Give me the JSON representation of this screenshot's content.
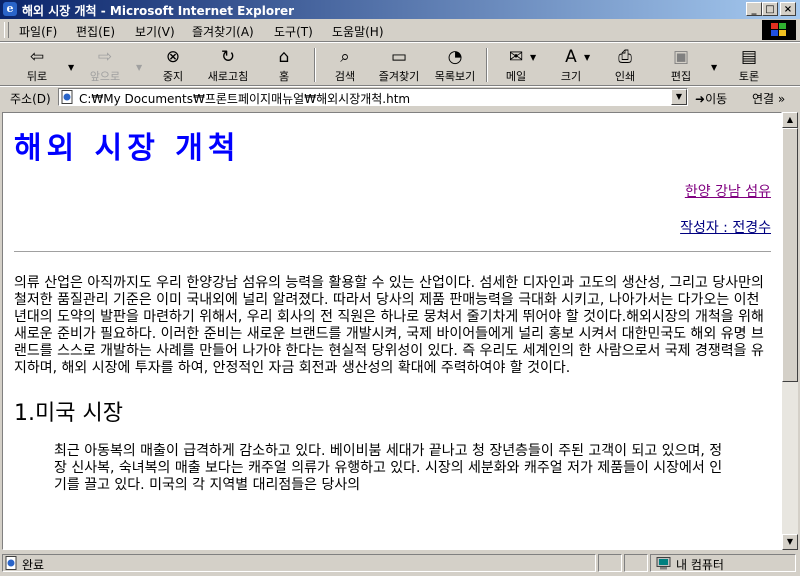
{
  "window": {
    "title": "해외 시장 개척 - Microsoft Internet Explorer",
    "min": "_",
    "max": "□",
    "close": "×"
  },
  "menu": [
    "파일(F)",
    "편집(E)",
    "보기(V)",
    "즐겨찾기(A)",
    "도구(T)",
    "도움말(H)"
  ],
  "toolbar": {
    "back": "뒤로",
    "forward": "앞으로",
    "stop": "중지",
    "refresh": "새로고침",
    "home": "홈",
    "search": "검색",
    "favorites": "즐겨찾기",
    "history": "목록보기",
    "mail": "메일",
    "size": "크기",
    "print": "인쇄",
    "edit": "편집",
    "discuss": "토론"
  },
  "address": {
    "label": "주소(D)",
    "url": "C:₩My Documents₩프론트페이지매뉴얼₩해외시장개척.htm",
    "go": "이동",
    "links": "연결"
  },
  "doc": {
    "title": "해외 시장 개척",
    "company_link": "한양 강남 섬유",
    "author_link": "작성자 : 전경수",
    "intro": "의류 산업은 아직까지도 우리 한양강남 섬유의 능력을 활용할 수 있는 산업이다. 섬세한 디자인과 고도의 생산성, 그리고 당사만의 철저한 품질관리 기준은 이미 국내외에 널리 알려졌다. 따라서 당사의 제품 판매능력을 극대화 시키고, 나아가서는 다가오는 이천년대의 도약의 발판을 마련하기 위해서, 우리 회사의 전 직원은 하나로 뭉쳐서 줄기차게 뛰어야 할 것이다.해외시장의 개척을 위해 새로운 준비가 필요하다. 이러한 준비는 새로운 브랜드를 개발시켜, 국제 바이어들에게 널리 홍보 시켜서 대한민국도 해외 유명 브랜드를 스스로 개발하는 사례를 만들어 나가야 한다는 현실적 당위성이 있다. 즉 우리도 세계인의 한 사람으로서 국제 경쟁력을 유지하며, 해외 시장에 투자를 하여, 안정적인 자금 회전과 생산성의 확대에 주력하여야 할 것이다.",
    "section1_title": "1.미국 시장",
    "section1_body": "최근 아동복의 매출이 급격하게 감소하고 있다. 베이비붐 세대가 끝나고 청 장년층들이 주된 고객이 되고 있으며, 정장 신사복, 숙녀복의 매출 보다는 캐주얼 의류가 유행하고 있다. 시장의 세분화와 캐주얼 저가 제품들이 시장에서 인기를 끌고 있다. 미국의 각 지역별 대리점들은 당사의"
  },
  "status": {
    "text": "완료",
    "zone": "내 컴퓨터"
  }
}
